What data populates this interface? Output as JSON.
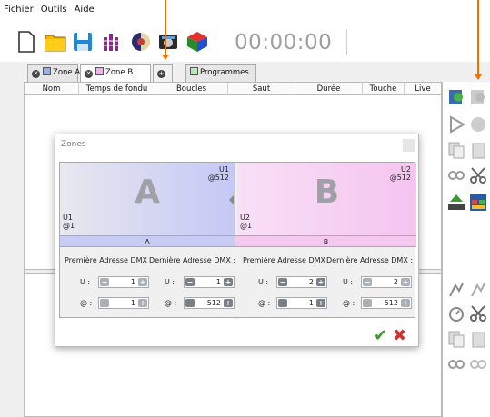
{
  "menu": {
    "items": [
      "Fichier",
      "Outils",
      "Aide"
    ]
  },
  "toolbar": {
    "icons": [
      "new-file-icon",
      "open-folder-icon",
      "save-icon",
      "grid-icon",
      "palette-icon",
      "midi-device-icon",
      "rubik-cube-icon"
    ],
    "timer": "00:00:00"
  },
  "tabs": [
    {
      "label": "Zone A",
      "color": "#9ab0e8"
    },
    {
      "label": "Zone B",
      "color": "#f5b0f0"
    },
    {
      "label": "Programmes",
      "color": "#b8e8b8"
    }
  ],
  "table": {
    "columns": [
      "Nom",
      "Temps de fondu",
      "Boucles",
      "Saut",
      "Durée",
      "Touche",
      "Live"
    ]
  },
  "dialog": {
    "title": "Zones",
    "zone_a": {
      "letter": "A",
      "top_universe": "U1",
      "top_address": "@512",
      "bottom_universe": "U1",
      "bottom_address": "@1",
      "header": "A",
      "first_label": "Première Adresse DMX",
      "last_label": "Dernière Adresse DMX :",
      "u_label": "U :",
      "at_label": "@ :",
      "first_u": "1",
      "first_at": "1",
      "last_u": "1",
      "last_at": "512",
      "color": "#c4c8f5"
    },
    "zone_b": {
      "letter": "B",
      "top_universe": "U2",
      "top_address": "@512",
      "bottom_universe": "U2",
      "bottom_address": "@1",
      "header": "B",
      "first_label": "Première Adresse DMX",
      "last_label": "Dernière Adresse DMX :",
      "u_label": "U :",
      "at_label": "@ :",
      "first_u": "2",
      "first_at": "1",
      "last_u": "2",
      "last_at": "512",
      "color": "#f5c4f0"
    },
    "spin_minus": "−",
    "spin_plus": "+",
    "ok_glyph": "✔",
    "cancel_glyph": "✖"
  },
  "colors": {
    "accent_arrow": "#f07000"
  }
}
